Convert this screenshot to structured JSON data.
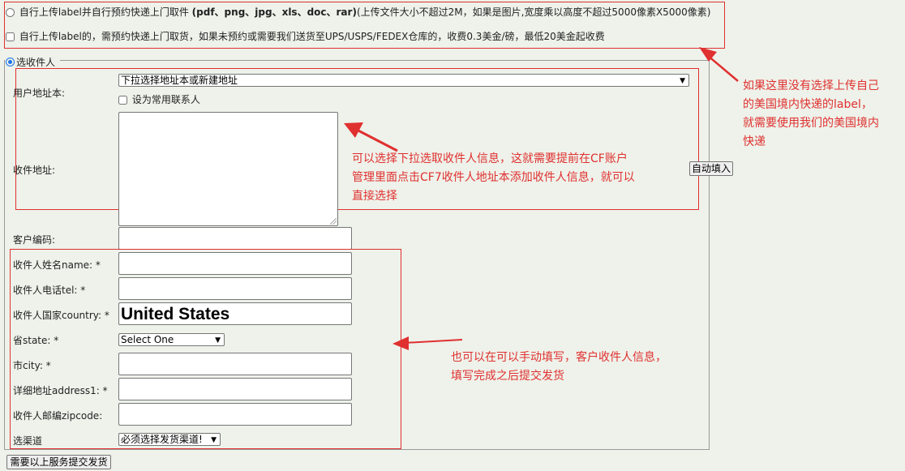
{
  "options": {
    "upload_label_pickup": "自行上传label并自行预约快递上门取件 (pdf、png、jpg、xls、doc、rar)(上传文件大小不超过2M，如果是图片,宽度乘以高度不超过5000像素X5000像素)",
    "upload_label_prefix": "自行上传label并自行预约快递上门取件 ",
    "upload_label_bold": "(pdf、png、jpg、xls、doc、rar)",
    "upload_label_suffix": "(上传文件大小不超过2M，如果是图片,宽度乘以高度不超过5000像素X5000像素)",
    "upload_label_reserve": "自行上传label的，需预约快递上门取货，如果未预约或需要我们送货至UPS/USPS/FEDEX仓库的，收费0.3美金/磅，最低20美金起收费"
  },
  "section": {
    "select_recipient": "选收件人"
  },
  "form": {
    "address_book_label": "用户地址本:",
    "address_book_select": "下拉选择地址本或新建地址",
    "set_common_contact": "设为常用联系人",
    "recipient_address_label": "收件地址:",
    "auto_fill_button": "自动填入",
    "customer_code_label": "客户编码:",
    "name_label": "收件人姓名name: *",
    "tel_label": "收件人电话tel: *",
    "country_label": "收件人国家country: *",
    "country_value": "United States",
    "state_label": "省state: *",
    "state_select": "Select One",
    "city_label": "市city: *",
    "address1_label": "详细地址address1: *",
    "zipcode_label": "收件人邮编zipcode:",
    "channel_label": "选渠道",
    "channel_select": "必须选择发货渠道!",
    "submit_button": "需要以上服务提交发货"
  },
  "annotations": {
    "note_top_right": [
      "如果这里没有选择上传自己",
      "的美国境内快递的label，",
      "就需要使用我们的美国境内",
      "快递"
    ],
    "note_middle": [
      "可以选择下拉选取收件人信息，这就需要提前在CF账户",
      "管理里面点击CF7收件人地址本添加收件人信息，就可以",
      "直接选择"
    ],
    "note_bottom": [
      "也可以在可以手动填写，客户收件人信息，",
      "填写完成之后提交发货"
    ]
  },
  "colors": {
    "annotation_red": "#e03030",
    "radio_blue": "#1a73e8",
    "background": "#eef2ea"
  }
}
